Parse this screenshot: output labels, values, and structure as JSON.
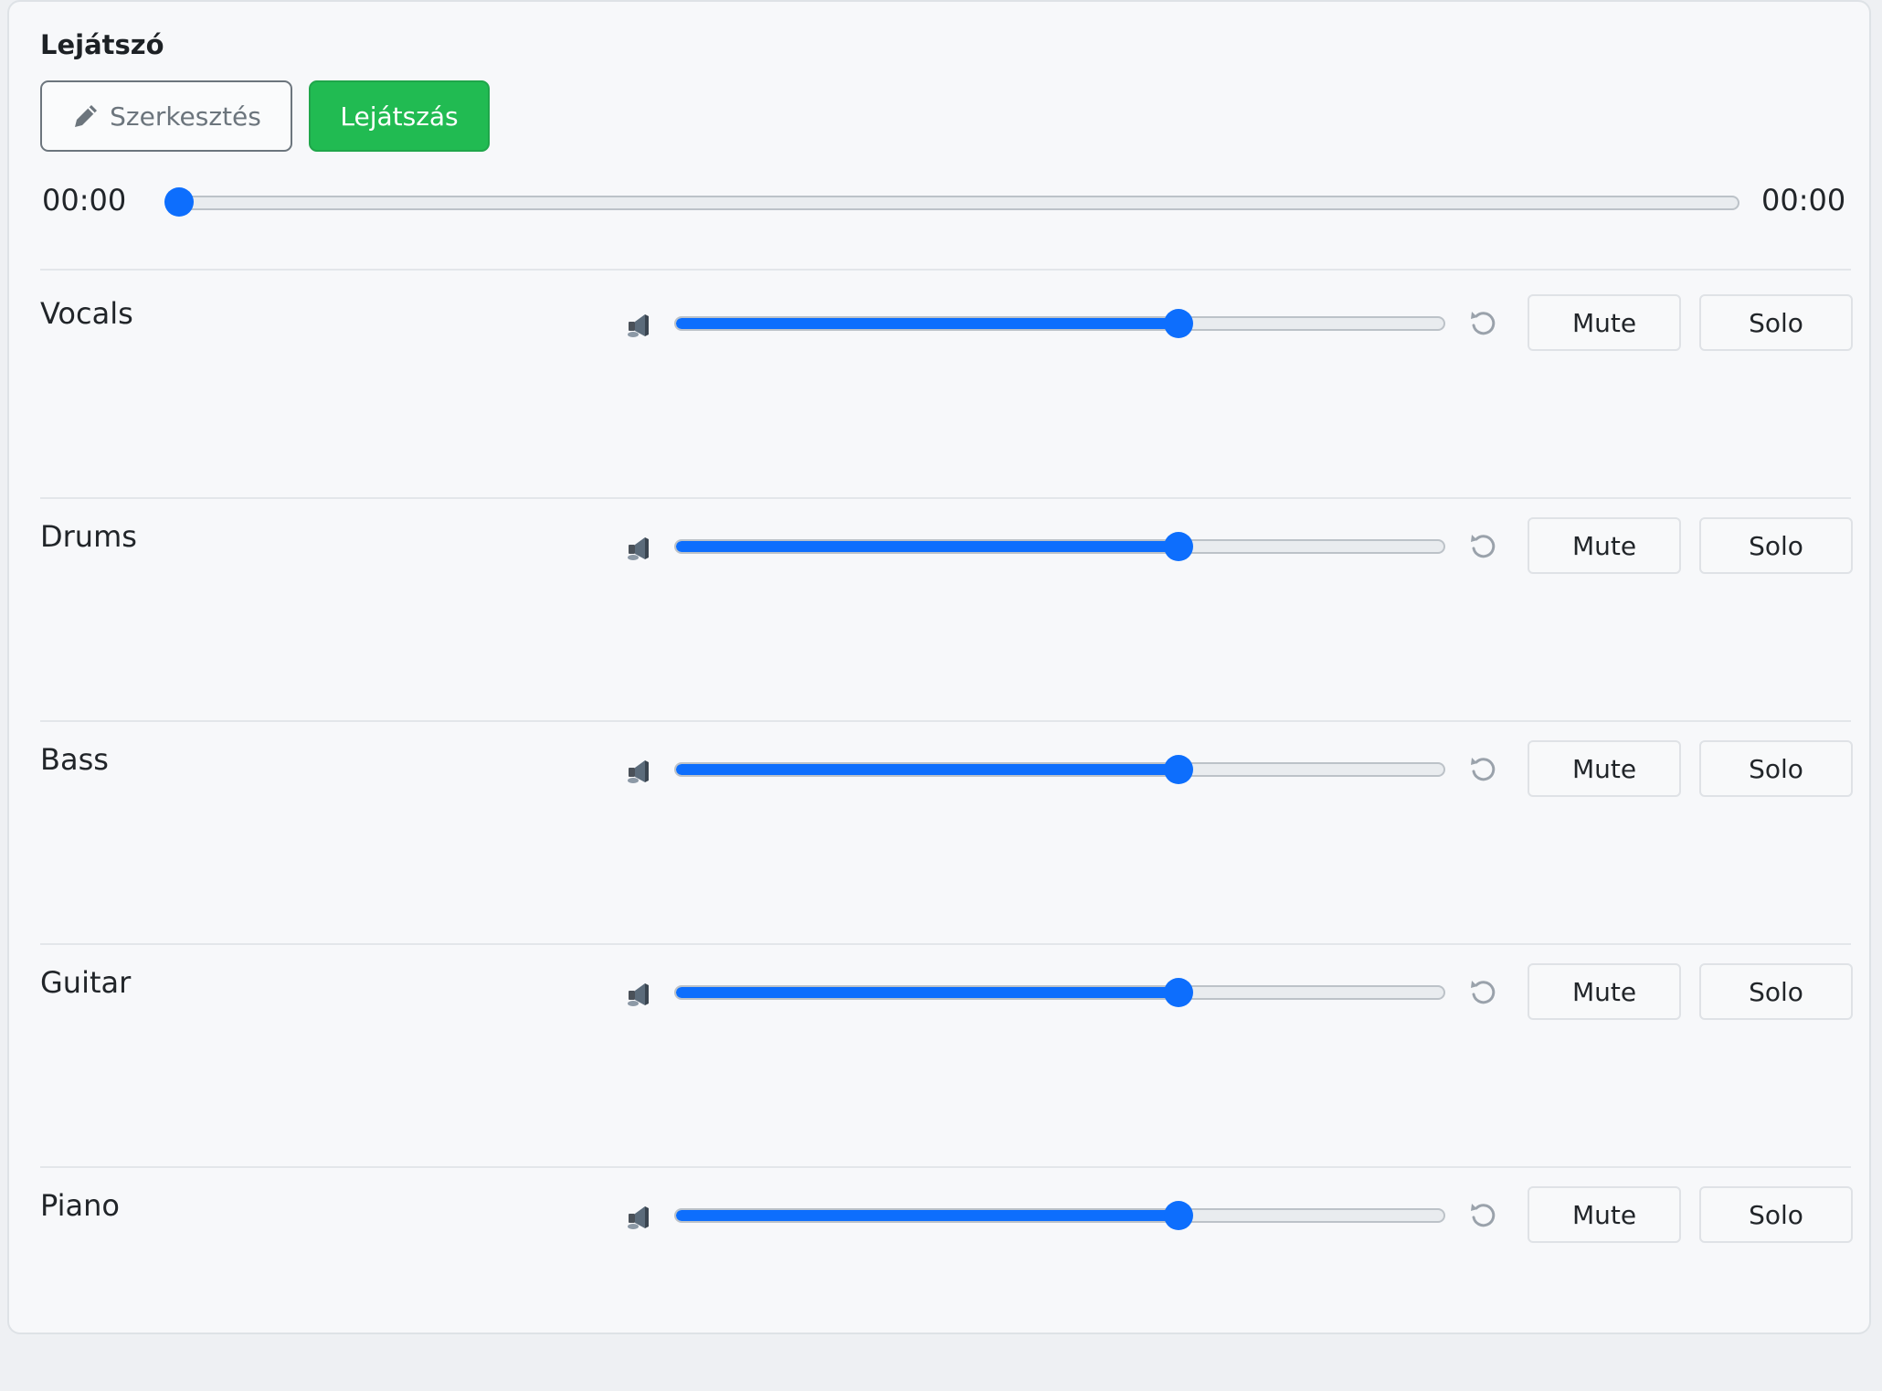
{
  "player": {
    "title": "Lejátszó",
    "edit_label": "Szerkesztés",
    "edit_icon": "pencil-icon",
    "play_label": "Lejátszás",
    "current_time": "00:00",
    "total_time": "00:00",
    "progress": 0
  },
  "colors": {
    "accent": "#0d6efd",
    "success": "#21bb52"
  },
  "tracks": [
    {
      "name": "Vocals",
      "volume": 0.66,
      "mute_label": "Mute",
      "solo_label": "Solo",
      "speaker_icon": "speaker-icon",
      "reset_icon": "reset-icon"
    },
    {
      "name": "Drums",
      "volume": 0.66,
      "mute_label": "Mute",
      "solo_label": "Solo",
      "speaker_icon": "speaker-icon",
      "reset_icon": "reset-icon"
    },
    {
      "name": "Bass",
      "volume": 0.66,
      "mute_label": "Mute",
      "solo_label": "Solo",
      "speaker_icon": "speaker-icon",
      "reset_icon": "reset-icon"
    },
    {
      "name": "Guitar",
      "volume": 0.66,
      "mute_label": "Mute",
      "solo_label": "Solo",
      "speaker_icon": "speaker-icon",
      "reset_icon": "reset-icon"
    },
    {
      "name": "Piano",
      "volume": 0.66,
      "mute_label": "Mute",
      "solo_label": "Solo",
      "speaker_icon": "speaker-icon",
      "reset_icon": "reset-icon"
    }
  ]
}
